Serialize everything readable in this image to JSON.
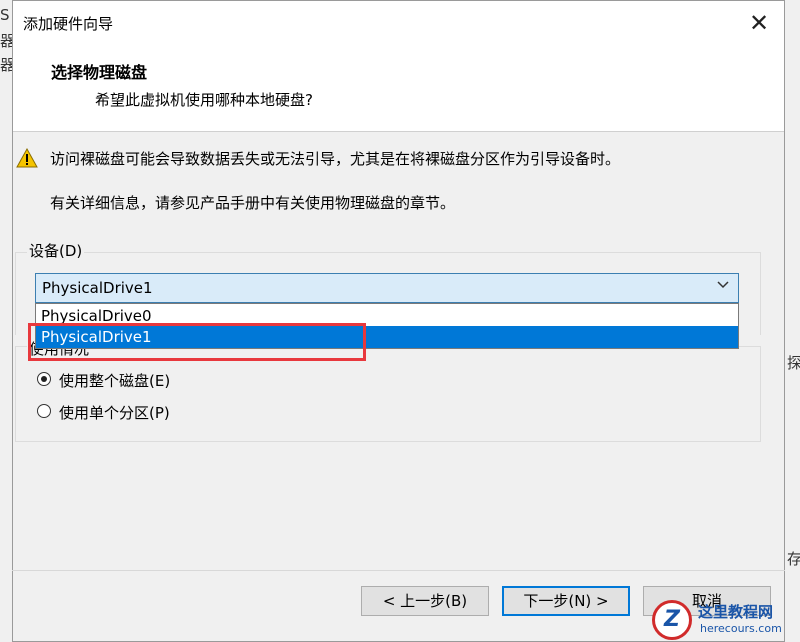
{
  "background": {
    "left_chars": [
      "S",
      "器",
      "器"
    ],
    "right_chars": [
      "探",
      "存"
    ]
  },
  "dialog": {
    "title": "添加硬件向导",
    "close_glyph": "✕"
  },
  "header": {
    "title": "选择物理磁盘",
    "subtitle": "希望此虚拟机使用哪种本地硬盘?"
  },
  "warning": {
    "icon": "warning-icon",
    "text": "访问裸磁盘可能会导致数据丢失或无法引导，尤其是在将裸磁盘分区作为引导设备时。"
  },
  "info": {
    "text": "有关详细信息，请参见产品手册中有关使用物理磁盘的章节。"
  },
  "device": {
    "label": "设备(D)",
    "selected": "PhysicalDrive1",
    "options": [
      "PhysicalDrive0",
      "PhysicalDrive1"
    ]
  },
  "usage": {
    "label": "使用情况",
    "options": [
      {
        "label": "使用整个磁盘(E)",
        "selected": true
      },
      {
        "label": "使用单个分区(P)",
        "selected": false
      }
    ]
  },
  "buttons": {
    "back": "< 上一步(B)",
    "next": "下一步(N) >",
    "cancel": "取消"
  },
  "watermark": {
    "title": "这里教程网",
    "url": "herecours.com"
  },
  "colors": {
    "selection": "#0078d7",
    "annotation_border": "#e8383d",
    "combo_bg": "#d9ebf9"
  }
}
